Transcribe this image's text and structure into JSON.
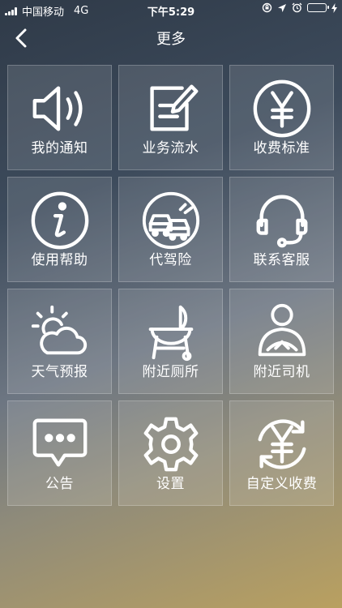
{
  "status_bar": {
    "carrier": "中国移动",
    "network": "4G",
    "time": "下午5:29",
    "battery_color": "#4cd964"
  },
  "nav": {
    "back_icon": "chevron-left-icon",
    "title": "更多"
  },
  "menu": {
    "items": [
      {
        "label": "我的通知",
        "icon": "speaker-icon"
      },
      {
        "label": "业务流水",
        "icon": "edit-note-icon"
      },
      {
        "label": "收费标准",
        "icon": "yen-circle-icon"
      },
      {
        "label": "使用帮助",
        "icon": "info-icon"
      },
      {
        "label": "代驾险",
        "icon": "car-insurance-icon"
      },
      {
        "label": "联系客服",
        "icon": "headset-icon"
      },
      {
        "label": "天气预报",
        "icon": "weather-icon"
      },
      {
        "label": "附近厕所",
        "icon": "grill-icon"
      },
      {
        "label": "附近司机",
        "icon": "driver-icon"
      },
      {
        "label": "公告",
        "icon": "chat-bubble-icon"
      },
      {
        "label": "设置",
        "icon": "gear-icon"
      },
      {
        "label": "自定义收费",
        "icon": "yen-refresh-icon"
      }
    ]
  }
}
